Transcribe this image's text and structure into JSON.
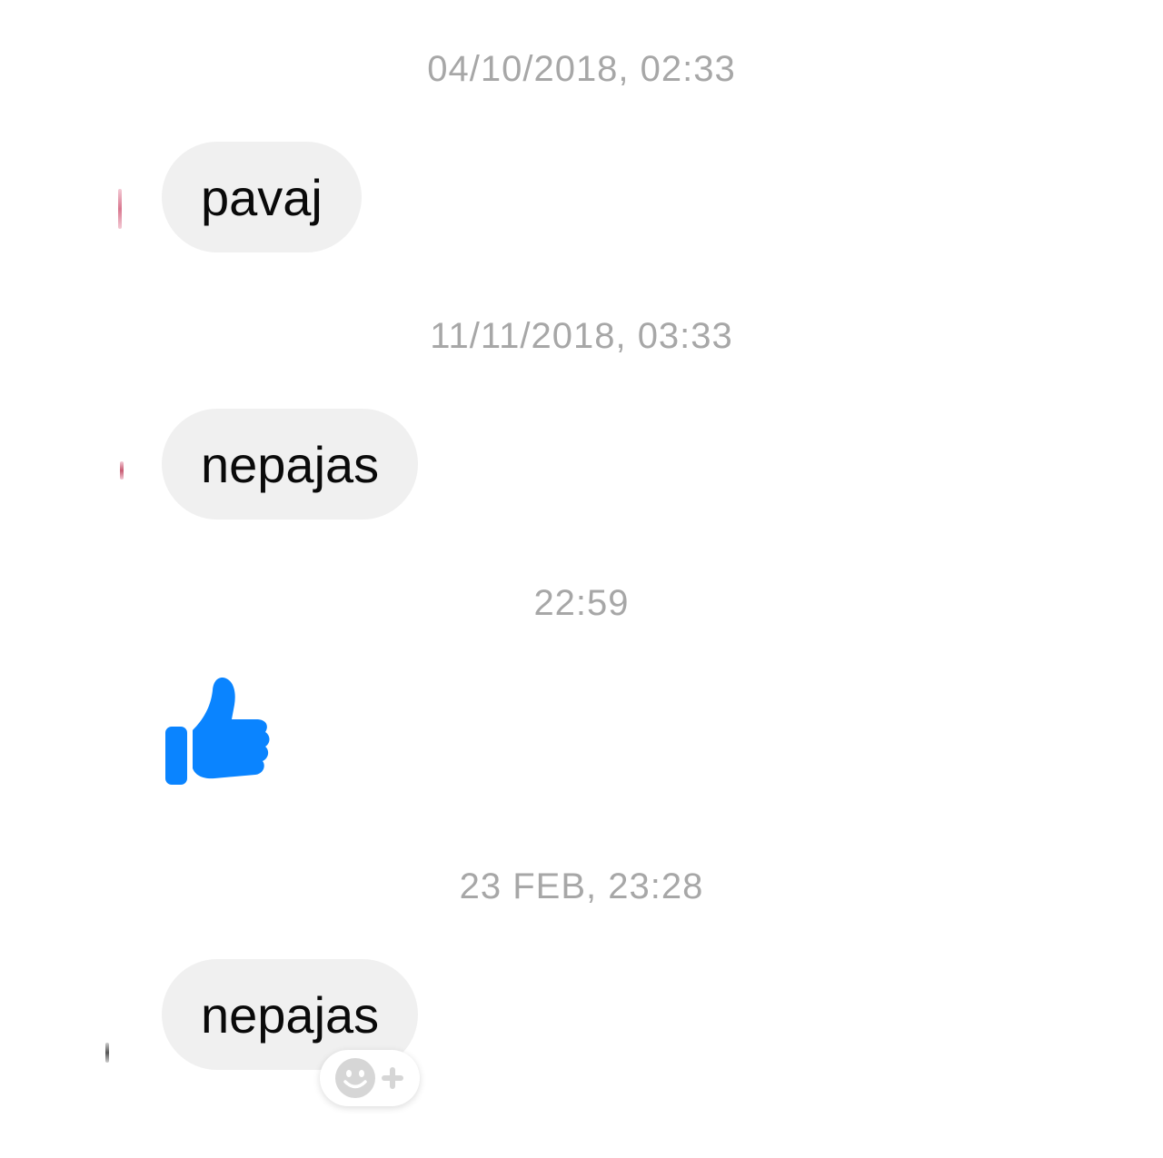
{
  "colors": {
    "bubble_bg": "#f0f0f0",
    "timestamp_text": "#a7a7a7",
    "message_text": "#0a0a0a",
    "like_blue": "#0a84ff",
    "reaction_icon": "#d6d6d6"
  },
  "messages": [
    {
      "timestamp": "04/10/2018, 02:33",
      "text": "pavaj"
    },
    {
      "timestamp": "11/11/2018, 03:33",
      "text": "nepajas"
    },
    {
      "timestamp": "22:59",
      "sticker": "thumbs-up-icon"
    },
    {
      "timestamp": "23 FEB, 23:28",
      "text": "nepajas",
      "reaction_button": "add-reaction-icon"
    }
  ]
}
